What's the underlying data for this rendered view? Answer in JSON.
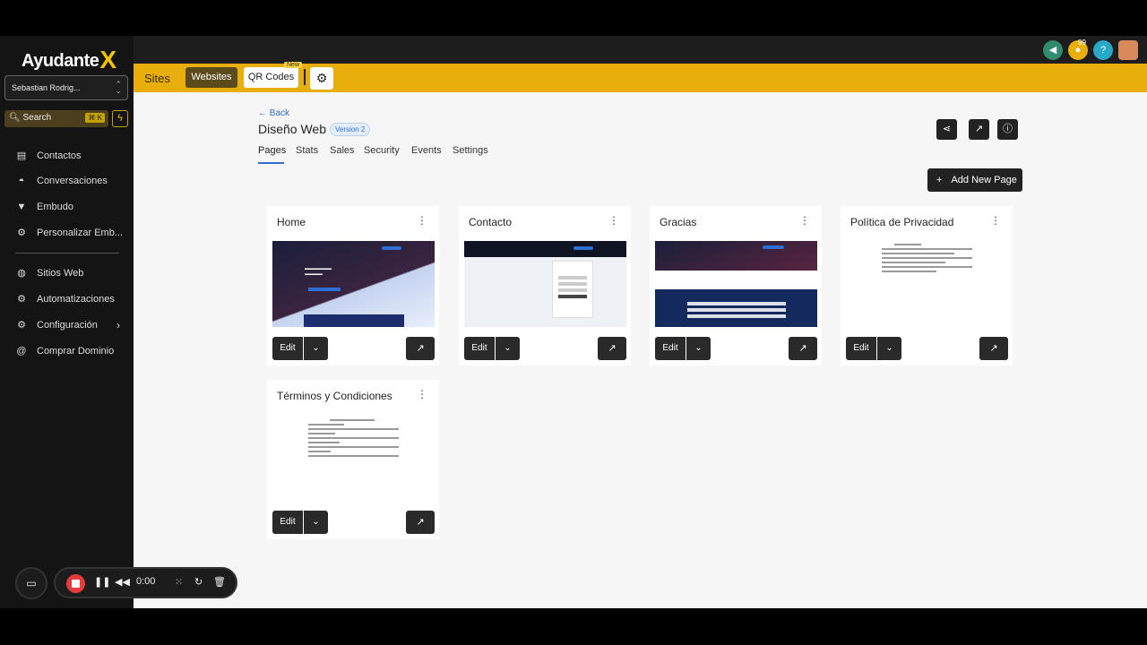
{
  "app": {
    "logo_text": "Ayudante",
    "logo_x": "X"
  },
  "sidebar": {
    "account": "Sebastian Rodrig...",
    "search_label": "Search",
    "search_shortcut": "⌘ K",
    "items": [
      {
        "label": "Contactos",
        "icon": "contact-card-icon"
      },
      {
        "label": "Conversaciones",
        "icon": "chat-icon"
      },
      {
        "label": "Embudo",
        "icon": "funnel-icon"
      },
      {
        "label": "Personalizar Emb...",
        "icon": "gear-icon"
      },
      {
        "label": "Sitios Web",
        "icon": "globe-icon"
      },
      {
        "label": "Automatizaciones",
        "icon": "workflow-icon"
      },
      {
        "label": "Configuración",
        "icon": "gear-icon"
      },
      {
        "label": "Comprar Dominio",
        "icon": "at-icon"
      }
    ]
  },
  "topbar": {
    "notification_count": "99"
  },
  "header": {
    "section": "Sites",
    "tabs": [
      "Websites",
      "QR Codes"
    ],
    "new_tag": "New"
  },
  "page": {
    "back": "← Back",
    "title": "Diseño Web",
    "version": "Version 2",
    "tabs": [
      "Pages",
      "Stats",
      "Sales",
      "Security",
      "Events",
      "Settings"
    ],
    "add_button": "Add New Page"
  },
  "cards": [
    {
      "title": "Home",
      "edit": "Edit"
    },
    {
      "title": "Contacto",
      "edit": "Edit"
    },
    {
      "title": "Gracias",
      "edit": "Edit"
    },
    {
      "title": "Política de Privacidad",
      "edit": "Edit"
    },
    {
      "title": "Términos y Condiciones",
      "edit": "Edit"
    }
  ],
  "recorder": {
    "time": "0:00"
  },
  "colors": {
    "accent": "#e8af0c",
    "dark": "#222222",
    "link": "#3366cc"
  }
}
